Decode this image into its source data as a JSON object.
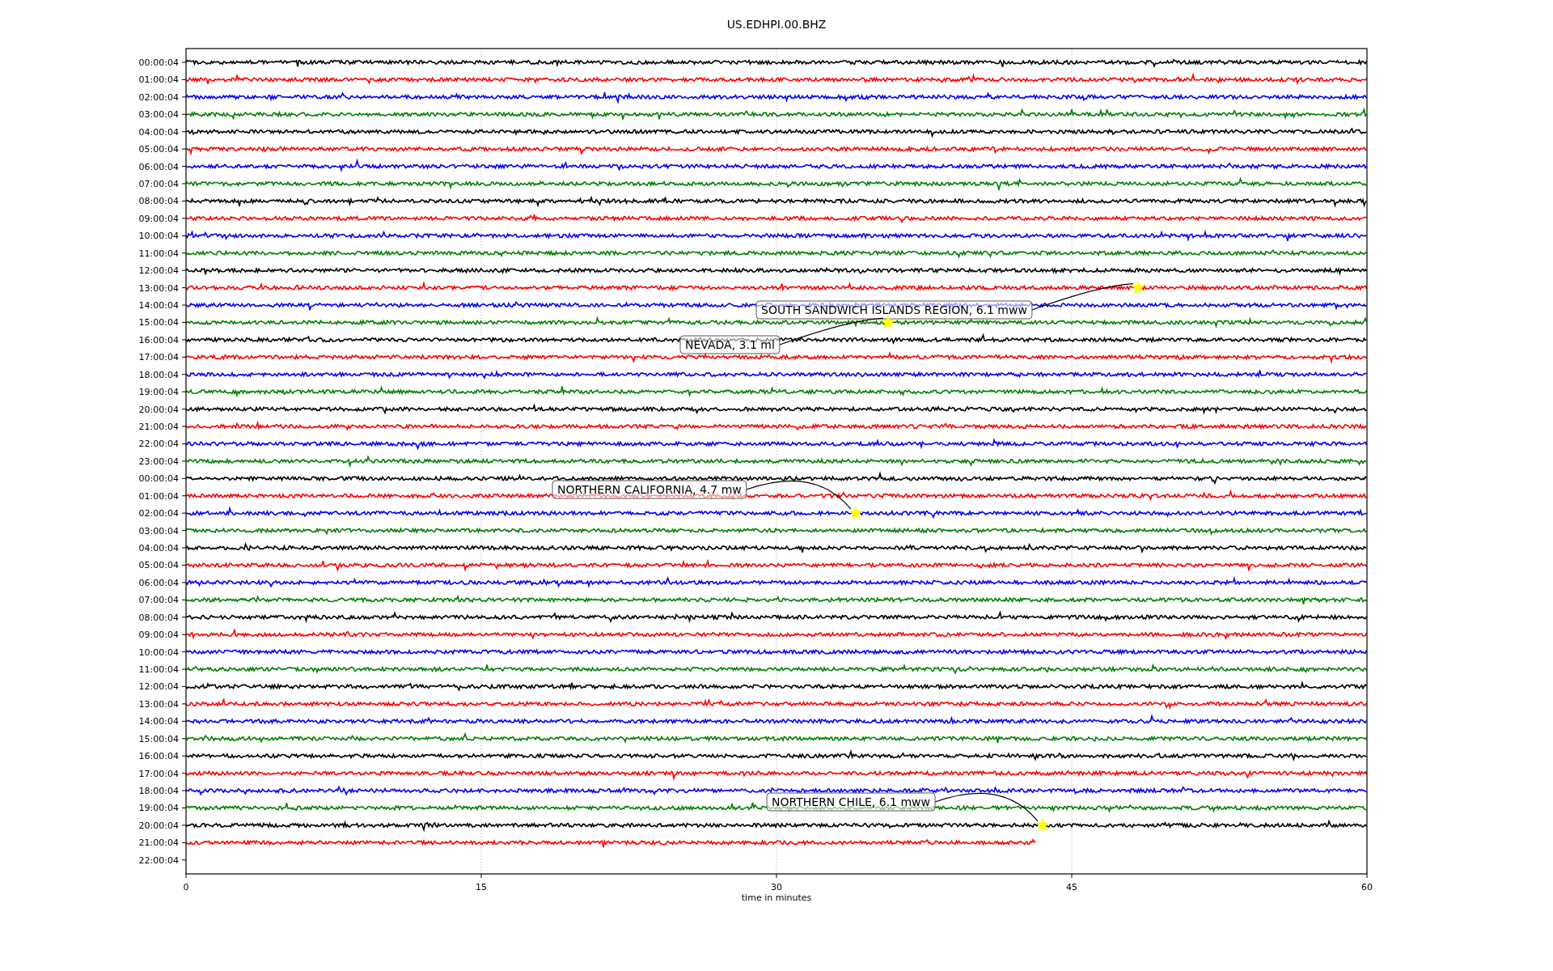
{
  "title": "US.EDHPI.00.BHZ",
  "rows": [
    {
      "label": "00:00:04",
      "trace": {
        "color": "#000000",
        "level": 1
      }
    },
    {
      "label": "01:00:04",
      "trace": {
        "color": "#ff0000",
        "level": 1
      }
    },
    {
      "label": "02:00:04",
      "trace": {
        "color": "#0000ff",
        "level": 1
      }
    },
    {
      "label": "03:00:04",
      "trace": {
        "color": "#008000",
        "level": 1
      }
    },
    {
      "label": "04:00:04",
      "trace": {
        "color": "#000000",
        "level": 1
      }
    },
    {
      "label": "05:00:04",
      "trace": {
        "color": "#ff0000",
        "level": 1
      }
    },
    {
      "label": "06:00:04",
      "trace": {
        "color": "#0000ff",
        "level": 1
      }
    },
    {
      "label": "07:00:04",
      "trace": {
        "color": "#008000",
        "level": 1
      }
    },
    {
      "label": "08:00:04",
      "trace": {
        "color": "#000000",
        "level": 1
      }
    },
    {
      "label": "09:00:04",
      "trace": {
        "color": "#ff0000",
        "level": 1
      }
    },
    {
      "label": "10:00:04",
      "trace": {
        "color": "#0000ff",
        "level": 1
      }
    },
    {
      "label": "11:00:04",
      "trace": {
        "color": "#008000",
        "level": 1
      }
    },
    {
      "label": "12:00:04",
      "trace": {
        "color": "#000000",
        "level": 1
      }
    },
    {
      "label": "13:00:04",
      "trace": {
        "color": "#ff0000",
        "level": 1
      }
    },
    {
      "label": "14:00:04",
      "trace": {
        "color": "#0000ff",
        "level": 1
      }
    },
    {
      "label": "15:00:04",
      "trace": {
        "color": "#008000",
        "level": 1
      }
    },
    {
      "label": "16:00:04",
      "trace": {
        "color": "#000000",
        "level": 1
      }
    },
    {
      "label": "17:00:04",
      "trace": {
        "color": "#ff0000",
        "level": 1
      }
    },
    {
      "label": "18:00:04",
      "trace": {
        "color": "#0000ff",
        "level": 1
      }
    },
    {
      "label": "19:00:04",
      "trace": {
        "color": "#008000",
        "level": 1
      }
    },
    {
      "label": "20:00:04",
      "trace": {
        "color": "#000000",
        "level": 1
      }
    },
    {
      "label": "21:00:04",
      "trace": {
        "color": "#ff0000",
        "level": 1
      }
    },
    {
      "label": "22:00:04",
      "trace": {
        "color": "#0000ff",
        "level": 1
      }
    },
    {
      "label": "23:00:04",
      "trace": {
        "color": "#008000",
        "level": 1
      }
    },
    {
      "label": "00:00:04",
      "trace": {
        "color": "#000000",
        "level": 1
      }
    },
    {
      "label": "01:00:04",
      "trace": {
        "color": "#ff0000",
        "level": 1
      }
    },
    {
      "label": "02:00:04",
      "trace": {
        "color": "#0000ff",
        "level": 1
      }
    },
    {
      "label": "03:00:04",
      "trace": {
        "color": "#008000",
        "level": 1
      }
    },
    {
      "label": "04:00:04",
      "trace": {
        "color": "#000000",
        "level": 1
      }
    },
    {
      "label": "05:00:04",
      "trace": {
        "color": "#ff0000",
        "level": 1
      }
    },
    {
      "label": "06:00:04",
      "trace": {
        "color": "#0000ff",
        "level": 1
      }
    },
    {
      "label": "07:00:04",
      "trace": {
        "color": "#008000",
        "level": 1
      }
    },
    {
      "label": "08:00:04",
      "trace": {
        "color": "#000000",
        "level": 1
      }
    },
    {
      "label": "09:00:04",
      "trace": {
        "color": "#ff0000",
        "level": 1
      }
    },
    {
      "label": "10:00:04",
      "trace": {
        "color": "#0000ff",
        "level": 1
      }
    },
    {
      "label": "11:00:04",
      "trace": {
        "color": "#008000",
        "level": 1
      }
    },
    {
      "label": "12:00:04",
      "trace": {
        "color": "#000000",
        "level": 1
      }
    },
    {
      "label": "13:00:04",
      "trace": {
        "color": "#ff0000",
        "level": 1
      }
    },
    {
      "label": "14:00:04",
      "trace": {
        "color": "#0000ff",
        "level": 1
      }
    },
    {
      "label": "15:00:04",
      "trace": {
        "color": "#008000",
        "level": 1
      }
    },
    {
      "label": "16:00:04",
      "trace": {
        "color": "#000000",
        "level": 1
      }
    },
    {
      "label": "17:00:04",
      "trace": {
        "color": "#ff0000",
        "level": 1
      }
    },
    {
      "label": "18:00:04",
      "trace": {
        "color": "#0000ff",
        "level": 1
      }
    },
    {
      "label": "19:00:04",
      "trace": {
        "color": "#008000",
        "level": 1
      }
    },
    {
      "label": "20:00:04",
      "trace": {
        "color": "#000000",
        "level": 1
      }
    },
    {
      "label": "21:00:04",
      "trace": {
        "color": "#ff0000",
        "level": 0.72
      }
    },
    {
      "label": "22:00:04"
    }
  ],
  "x_axis": {
    "ticks": [
      "0",
      "15",
      "30",
      "45",
      "60"
    ],
    "label": "time in minutes"
  },
  "annotations": [
    {
      "text": "SOUTH SANDWICH ISLANDS REGION, 6.1 mww"
    },
    {
      "text": "NEVADA, 3.1 ml"
    },
    {
      "text": "NORTHERN CALIFORNIA, 4.7 mw"
    },
    {
      "text": "NORTHERN CHILE, 6.1 mww"
    }
  ]
}
